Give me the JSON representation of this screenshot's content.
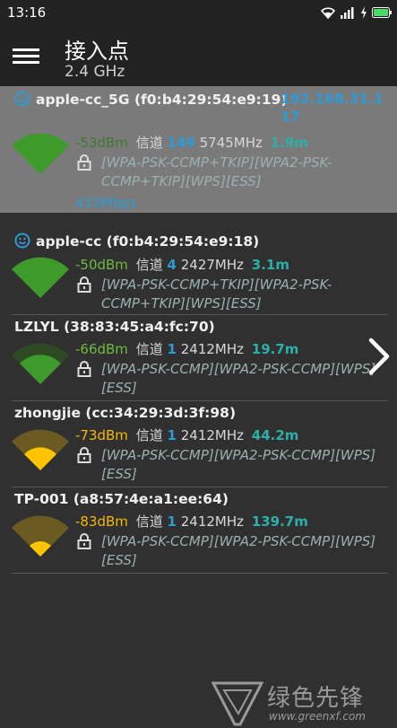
{
  "status_bar": {
    "time": "13:16"
  },
  "header": {
    "title": "接入点",
    "subtitle": "2.4 GHz"
  },
  "colors": {
    "signal_green": "#3f9a2c",
    "signal_yellow": "#ffc400",
    "link_blue": "#2e9bd6",
    "distance_teal": "#2ab0a8"
  },
  "access_points": [
    {
      "name": "apple-cc_5G (f0:b4:29:54:e9:19)",
      "ip": "192.168.31.117",
      "dbm": "-53dBm",
      "channel_label": "信道",
      "channel": "149",
      "freq": "5745MHz",
      "distance": "1.9m",
      "capabilities": "[WPA-PSK-CCMP+TKIP][WPA2-PSK-CCMP+TKIP][WPS][ESS]",
      "speed": "433Mbps",
      "signal_level": 0.9,
      "signal_color": "#3f9a2c",
      "connected_icon": "smiley-icon"
    },
    {
      "name": "apple-cc (f0:b4:29:54:e9:18)",
      "dbm": "-50dBm",
      "channel_label": "信道",
      "channel": "4",
      "freq": "2427MHz",
      "distance": "3.1m",
      "capabilities": "[WPA-PSK-CCMP+TKIP][WPA2-PSK-CCMP+TKIP][WPS][ESS]",
      "signal_level": 1.0,
      "signal_color": "#3f9a2c",
      "connected_icon": "smiley-icon"
    },
    {
      "name": "LZLYL (38:83:45:a4:fc:70)",
      "dbm": "-66dBm",
      "channel_label": "信道",
      "channel": "1",
      "freq": "2412MHz",
      "distance": "19.7m",
      "capabilities": "[WPA-PSK-CCMP][WPA2-PSK-CCMP][WPS][ESS]",
      "signal_level": 0.66,
      "signal_color": "#3f9a2c"
    },
    {
      "name": "zhongjie (cc:34:29:3d:3f:98)",
      "dbm": "-73dBm",
      "channel_label": "信道",
      "channel": "1",
      "freq": "2412MHz",
      "distance": "44.2m",
      "capabilities": "[WPA-PSK-CCMP][WPA2-PSK-CCMP][WPS][ESS]",
      "signal_level": 0.5,
      "signal_color": "#ffc400"
    },
    {
      "name": "TP-001 (a8:57:4e:a1:ee:64)",
      "dbm": "-83dBm",
      "channel_label": "信道",
      "channel": "1",
      "freq": "2412MHz",
      "distance": "139.7m",
      "capabilities": "[WPA-PSK-CCMP][WPA2-PSK-CCMP][WPS][ESS]",
      "signal_level": 0.33,
      "signal_color": "#ffc400"
    }
  ],
  "watermark": {
    "text": "绿色先锋",
    "url": "www.greenxf.com"
  }
}
